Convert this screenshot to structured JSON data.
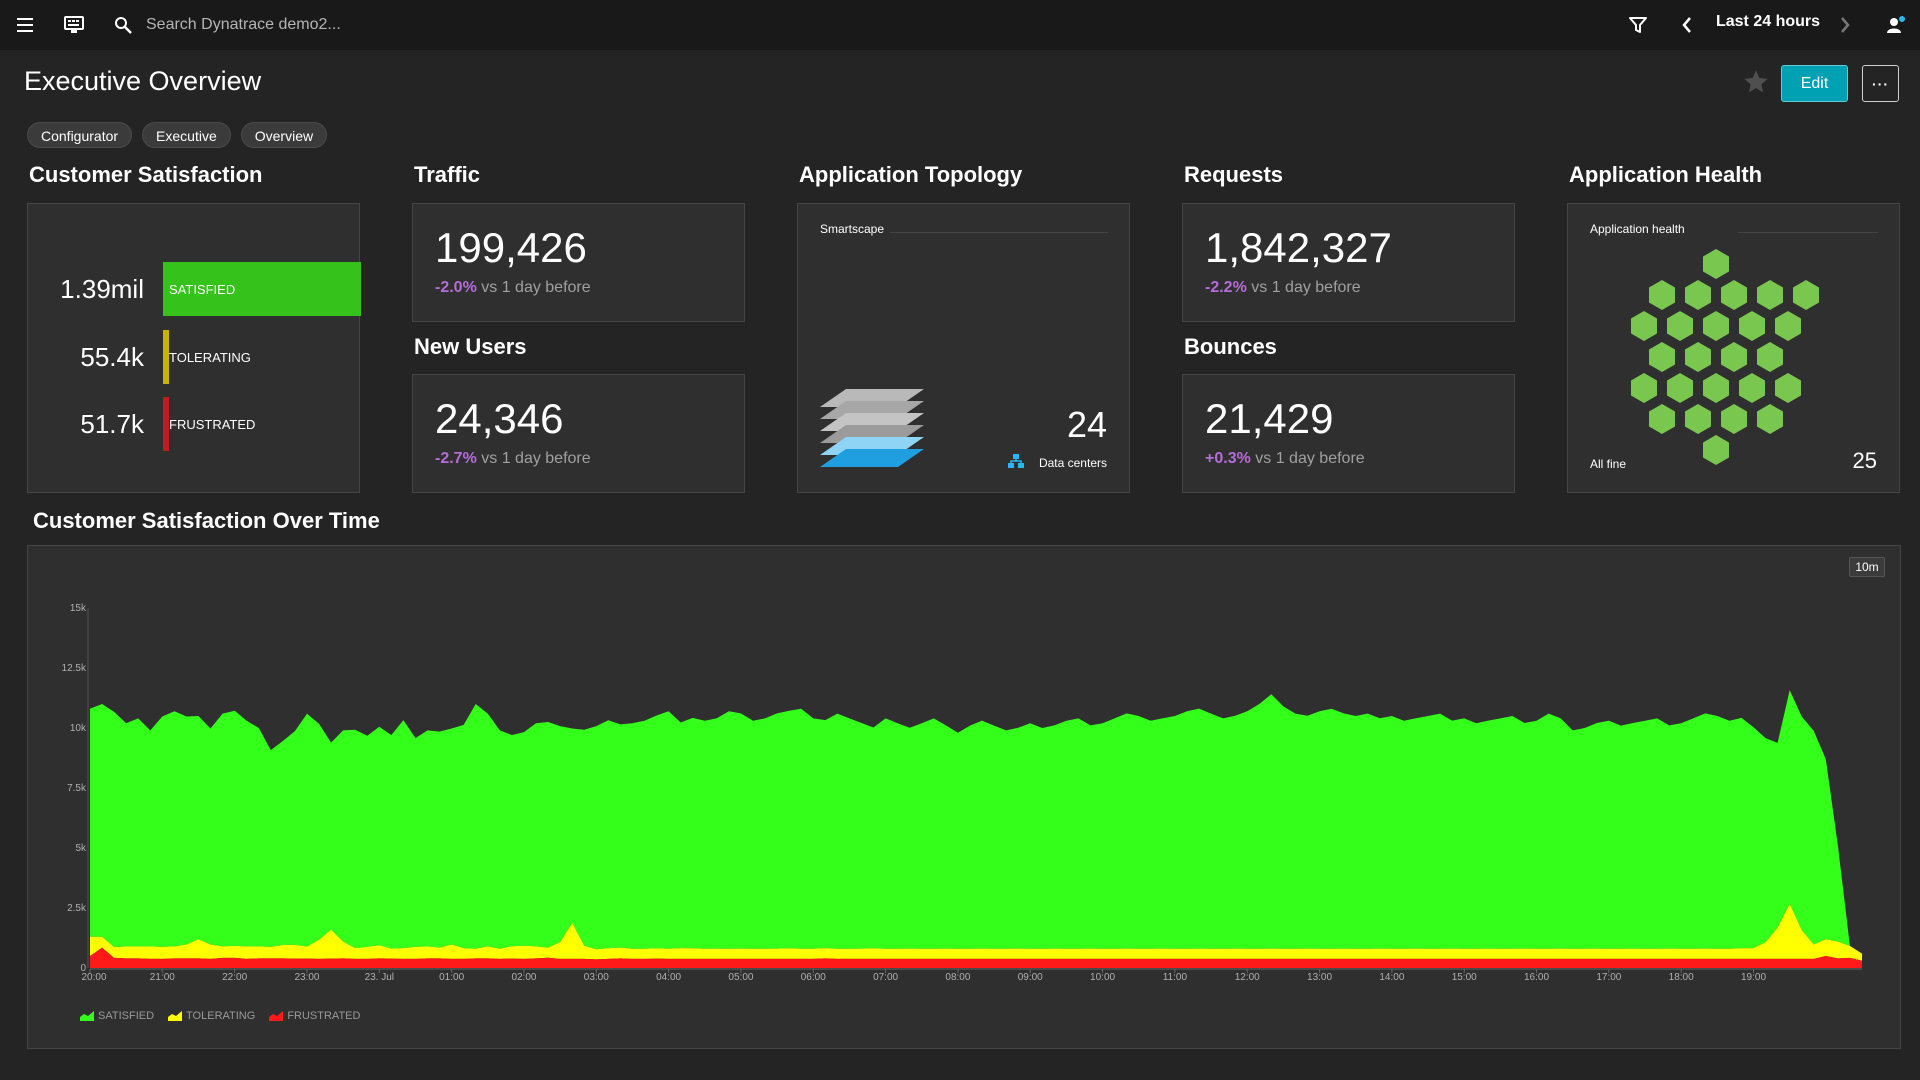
{
  "topbar": {
    "search_placeholder": "Search Dynatrace demo2...",
    "timeframe": "Last 24 hours"
  },
  "page": {
    "title": "Executive Overview",
    "edit_label": "Edit",
    "more_label": "···",
    "tags": [
      "Configurator",
      "Executive",
      "Overview"
    ]
  },
  "customer_satisfaction": {
    "title": "Customer Satisfaction",
    "rows": [
      {
        "value": "1.39mil",
        "label": "SATISFIED",
        "color": "#35c21b",
        "share": 1.0
      },
      {
        "value": "55.4k",
        "label": "TOLERATING",
        "color": "#c9b200",
        "share": 0.04
      },
      {
        "value": "51.7k",
        "label": "FRUSTRATED",
        "color": "#c21b1b",
        "share": 0.037
      }
    ]
  },
  "traffic": {
    "title": "Traffic",
    "value": "199,426",
    "delta": "-2.0%",
    "delta_text": "vs 1 day before"
  },
  "new_users": {
    "title": "New Users",
    "value": "24,346",
    "delta": "-2.7%",
    "delta_text": "vs 1 day before"
  },
  "topology": {
    "title": "Application Topology",
    "subtitle": "Smartscape",
    "count": "24",
    "count_label": "Data centers"
  },
  "requests": {
    "title": "Requests",
    "value": "1,842,327",
    "delta": "-2.2%",
    "delta_text": "vs 1 day before"
  },
  "bounces": {
    "title": "Bounces",
    "value": "21,429",
    "delta": "+0.3%",
    "delta_text": "vs 1 day before"
  },
  "health": {
    "title": "Application Health",
    "subtitle": "Application health",
    "status": "All fine",
    "count": "25",
    "color": "#7ac74f"
  },
  "chart_section": {
    "title": "Customer Satisfaction Over Time",
    "resolution": "10m"
  },
  "chart_data": {
    "type": "area",
    "stacked": true,
    "y_ticks": [
      "0",
      "2.5k",
      "5k",
      "7.5k",
      "10k",
      "12.5k",
      "15k"
    ],
    "ylim": [
      0,
      15000
    ],
    "x_ticks": [
      "20:00",
      "21:00",
      "22:00",
      "23:00",
      "23. Jul",
      "01:00",
      "02:00",
      "03:00",
      "04:00",
      "05:00",
      "06:00",
      "07:00",
      "08:00",
      "09:00",
      "10:00",
      "11:00",
      "12:00",
      "13:00",
      "14:00",
      "15:00",
      "16:00",
      "17:00",
      "18:00",
      "19:00"
    ],
    "x_start": "20:00",
    "x_step_minutes": 10,
    "legend": [
      "SATISFIED",
      "TOLERATING",
      "FRUSTRATED"
    ],
    "series": [
      {
        "name": "FRUSTRATED",
        "color": "#ff1a1a",
        "values": [
          500,
          850,
          420,
          400,
          400,
          380,
          380,
          400,
          400,
          400,
          380,
          420,
          420,
          380,
          400,
          400,
          400,
          390,
          390,
          380,
          390,
          400,
          380,
          380,
          400,
          390,
          380,
          380,
          400,
          400,
          380,
          380,
          400,
          400,
          380,
          390,
          380,
          400,
          430,
          380,
          380,
          380,
          360,
          380,
          400,
          380,
          380,
          390,
          380,
          380,
          380,
          380,
          380,
          380,
          380,
          380,
          380,
          380,
          380,
          380,
          380,
          400,
          380,
          380,
          380,
          380,
          380,
          380,
          380,
          380,
          380,
          380,
          380,
          380,
          380,
          380,
          380,
          380,
          380,
          380,
          380,
          380,
          380,
          380,
          380,
          380,
          380,
          380,
          380,
          380,
          380,
          380,
          380,
          380,
          380,
          380,
          380,
          380,
          380,
          380,
          380,
          380,
          380,
          380,
          380,
          380,
          380,
          380,
          380,
          380,
          380,
          380,
          380,
          380,
          380,
          380,
          380,
          380,
          380,
          380,
          380,
          380,
          380,
          380,
          380,
          380,
          380,
          380,
          380,
          380,
          380,
          380,
          380,
          380,
          380,
          380,
          380,
          380,
          380,
          380,
          380,
          380,
          380,
          380,
          500,
          400,
          420,
          300
        ]
      },
      {
        "name": "TOLERATING",
        "color": "#ffff00",
        "values": [
          800,
          450,
          450,
          500,
          500,
          520,
          500,
          500,
          580,
          800,
          600,
          480,
          500,
          520,
          500,
          480,
          560,
          580,
          500,
          800,
          1200,
          700,
          450,
          500,
          550,
          420,
          450,
          500,
          500,
          450,
          600,
          450,
          400,
          500,
          420,
          520,
          550,
          500,
          420,
          700,
          1500,
          550,
          420,
          440,
          450,
          420,
          420,
          430,
          420,
          450,
          440,
          420,
          430,
          420,
          430,
          420,
          420,
          430,
          440,
          420,
          420,
          430,
          420,
          420,
          430,
          440,
          420,
          420,
          430,
          420,
          420,
          430,
          420,
          420,
          430,
          420,
          420,
          430,
          420,
          420,
          430,
          420,
          420,
          430,
          420,
          420,
          430,
          420,
          420,
          430,
          420,
          420,
          430,
          420,
          420,
          430,
          420,
          420,
          430,
          420,
          420,
          430,
          420,
          420,
          430,
          420,
          420,
          430,
          420,
          420,
          430,
          420,
          420,
          430,
          420,
          420,
          430,
          420,
          420,
          430,
          420,
          420,
          430,
          420,
          420,
          430,
          420,
          420,
          430,
          420,
          420,
          430,
          420,
          420,
          430,
          420,
          420,
          440,
          450,
          700,
          1300,
          2300,
          1200,
          600,
          700,
          700,
          500,
          300
        ]
      },
      {
        "name": "SATISFIED",
        "color": "#33ff1a",
        "values": [
          9500,
          9700,
          9800,
          9300,
          9500,
          9000,
          9600,
          9800,
          9500,
          9300,
          9000,
          9700,
          9800,
          9400,
          9100,
          8200,
          8500,
          8900,
          9700,
          9000,
          7800,
          8800,
          9100,
          8800,
          9100,
          8900,
          9500,
          8700,
          9000,
          9000,
          9000,
          9300,
          10200,
          9700,
          9100,
          8800,
          8900,
          9300,
          9400,
          9000,
          8100,
          9000,
          9300,
          9500,
          9300,
          9400,
          9500,
          9700,
          9900,
          9400,
          9600,
          9500,
          9600,
          9900,
          9800,
          9500,
          9600,
          9800,
          9900,
          10000,
          9600,
          9500,
          9800,
          9600,
          9400,
          9200,
          9600,
          9400,
          9200,
          9400,
          9600,
          9300,
          9000,
          9300,
          9500,
          9300,
          9100,
          9200,
          9400,
          9200,
          9300,
          9500,
          9600,
          9300,
          9400,
          9600,
          9800,
          9700,
          9500,
          9600,
          9700,
          9900,
          10000,
          9800,
          9600,
          9700,
          9900,
          10200,
          10600,
          10100,
          9800,
          9700,
          9900,
          10000,
          9800,
          9700,
          9800,
          9600,
          9700,
          9500,
          9600,
          9700,
          9800,
          9500,
          9600,
          9400,
          9500,
          9600,
          9700,
          9400,
          9500,
          9800,
          9600,
          9100,
          9200,
          9400,
          9500,
          9300,
          9400,
          9500,
          9600,
          9300,
          9400,
          9600,
          9800,
          9700,
          9500,
          9600,
          9200,
          8500,
          7700,
          8900,
          8900,
          8900,
          7500,
          4000
        ]
      }
    ]
  }
}
